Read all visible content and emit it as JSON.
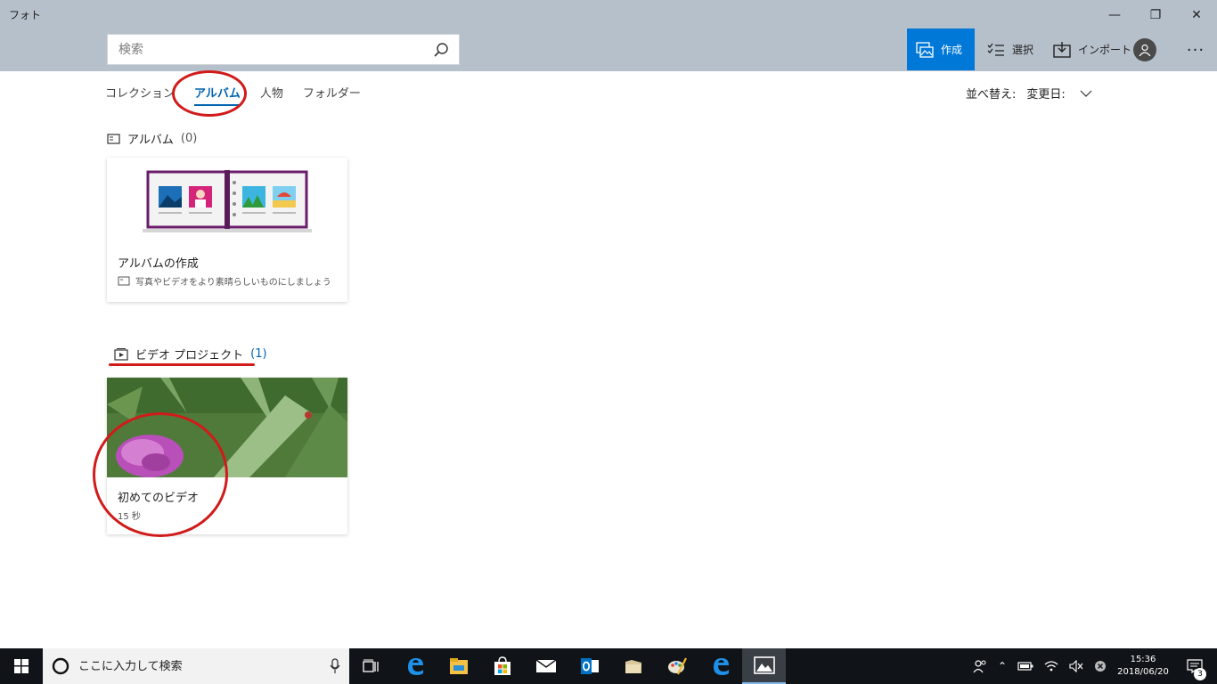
{
  "window": {
    "title": "フォト",
    "minimize_glyph": "—",
    "restore_glyph": "❐",
    "close_glyph": "✕"
  },
  "search": {
    "placeholder": "検索"
  },
  "commands": {
    "create": "作成",
    "select": "選択",
    "import": "インポート",
    "more": "···"
  },
  "tabs": [
    "コレクション",
    "アルバム",
    "人物",
    "フォルダー"
  ],
  "active_tab": "アルバム",
  "sort": {
    "label": "並べ替え:",
    "value": "変更日:"
  },
  "albums_section": {
    "title": "アルバム",
    "count": "(0)",
    "card": {
      "title": "アルバムの作成",
      "subtitle": "写真やビデオをより素晴らしいものにしましょう"
    }
  },
  "video_section": {
    "title": "ビデオ プロジェクト",
    "count": "(1)",
    "card": {
      "title": "初めてのビデオ",
      "duration": "15 秒"
    }
  },
  "taskbar": {
    "search_placeholder": "ここに入力して検索",
    "time": "15:36",
    "date": "2018/06/20",
    "notifications": "3"
  },
  "colors": {
    "header_bg": "#b6c0cb",
    "accent": "#0078d7",
    "active_tab": "#0063b1",
    "annotation": "#d11a1a",
    "taskbar": "#101418"
  },
  "icons": [
    "search-icon",
    "create-icon",
    "select-icon",
    "import-icon",
    "account-icon",
    "album-section-icon",
    "video-project-icon",
    "windows-start-icon",
    "cortana-icon",
    "microphone-icon",
    "task-view-icon",
    "edge-icon",
    "file-explorer-icon",
    "store-icon",
    "mail-icon",
    "outlook-icon",
    "folder-icon",
    "paint-icon",
    "photos-icon"
  ]
}
